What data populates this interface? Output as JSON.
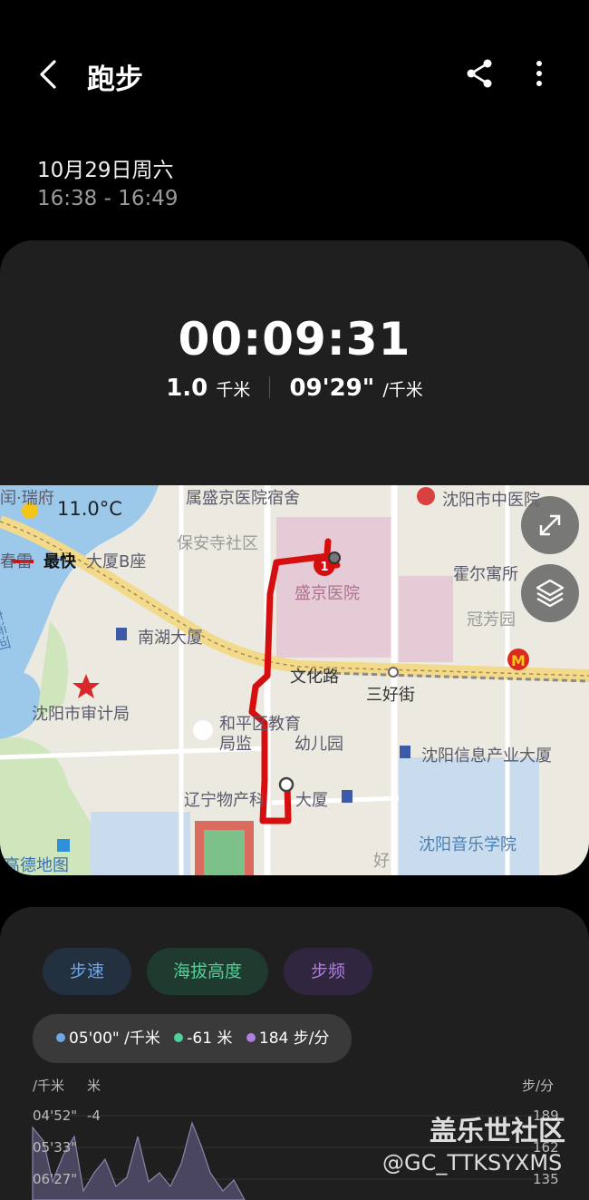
{
  "header": {
    "title": "跑步",
    "back_icon": "chevron-left-icon",
    "share_icon": "share-icon",
    "more_icon": "more-vertical-icon"
  },
  "session": {
    "date": "10月29日周六",
    "time_range": "16:38 - 16:49"
  },
  "summary": {
    "duration": "00:09:31",
    "distance": "1.0",
    "distance_unit": "千米",
    "pace": "09'29\"",
    "pace_unit": "/千米"
  },
  "map": {
    "weather": "11.0°C",
    "fastest": "最快",
    "route_marker": "1",
    "labels": {
      "l1": "闰·瑞府",
      "l2": "属盛京医院宿舍",
      "l3": "沈阳市中医院",
      "l4": "保安寺社区",
      "l5": "春雷",
      "l6": "大厦B座",
      "l7": "盛京医院",
      "l8": "霍尔寓所",
      "l9": "冠芳园",
      "l10": "南湖大厦",
      "l11": "文化路",
      "l12": "三好街",
      "l13": "南运河",
      "l14": "沈阳市审计局",
      "l15": "和平区教育",
      "l16": "局监",
      "l17": "幼儿园",
      "l18": "沈阳信息产业大厦",
      "l19": "辽宁物产科",
      "l20": "大厦",
      "l21": "沈阳音乐学院",
      "l22": "高德地图",
      "l23": "好"
    },
    "expand_icon": "expand-icon",
    "layers_icon": "layers-icon"
  },
  "graph": {
    "tabs": [
      {
        "label": "步速",
        "color": "#6fa8e8"
      },
      {
        "label": "海拔高度",
        "color": "#4fd19a"
      },
      {
        "label": "步频",
        "color": "#b07de0"
      }
    ],
    "legend": [
      {
        "text": "05'00\" /千米",
        "color": "#6fa8e8"
      },
      {
        "text": "-61 米",
        "color": "#4fd19a"
      },
      {
        "text": "184 步/分",
        "color": "#b07de0"
      }
    ],
    "axis": {
      "left_unit_1": "/千米",
      "left_unit_2": "米",
      "right_unit": "步/分",
      "pace_ticks": [
        "04'52\"",
        "05'33\"",
        "06'27\""
      ],
      "alt_ticks": [
        "-4"
      ],
      "cadence_ticks": [
        "189",
        "162",
        "135"
      ]
    }
  },
  "watermark": {
    "line1": "盖乐世社区",
    "line2": "@GC_TTKSYXMS"
  }
}
